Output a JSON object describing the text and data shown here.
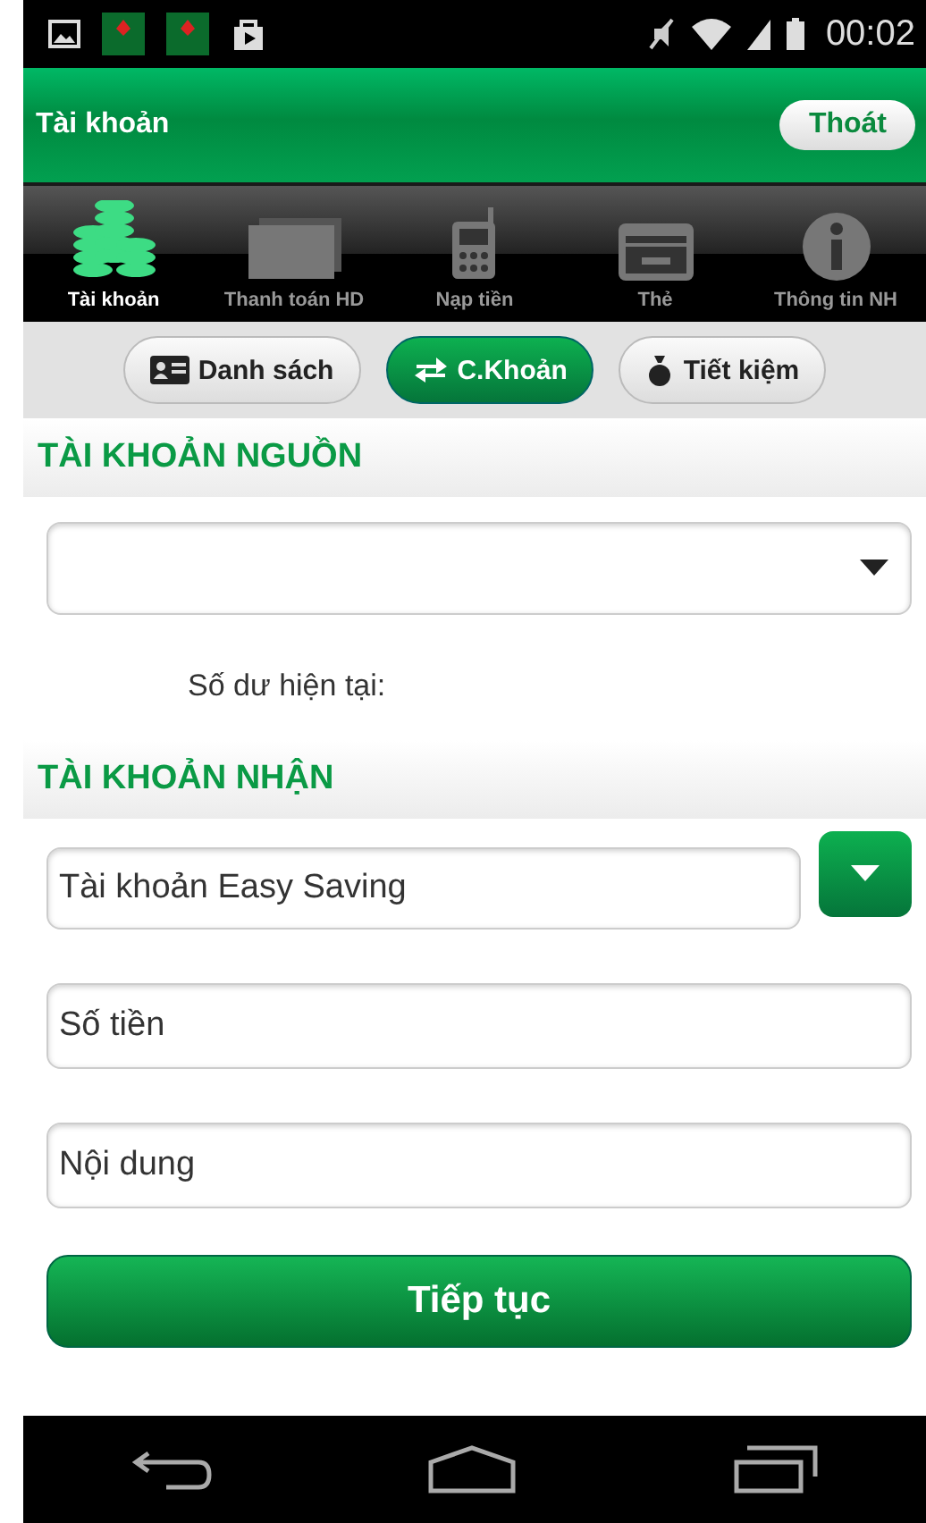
{
  "status_bar": {
    "time": "00:02"
  },
  "header": {
    "title": "Tài khoản",
    "logout_button": "Thoát"
  },
  "tabs": [
    {
      "label": "Tài khoản",
      "selected": true
    },
    {
      "label": "Thanh toán HD",
      "selected": false
    },
    {
      "label": "Nạp tiền",
      "selected": false
    },
    {
      "label": "Thẻ",
      "selected": false
    },
    {
      "label": "Thông tin NH",
      "selected": false
    }
  ],
  "segments": [
    {
      "label": "Danh sách",
      "selected": false
    },
    {
      "label": "C.Khoản",
      "selected": true
    },
    {
      "label": "Tiết kiệm",
      "selected": false
    }
  ],
  "source_section": {
    "title": "TÀI KHOẢN NGUỒN",
    "balance_label": "Số dư hiện tại:"
  },
  "target_section": {
    "title": "TÀI KHOẢN NHẬN",
    "account_value": "Tài khoản Easy Saving"
  },
  "amount_field": {
    "placeholder": "Số tiền"
  },
  "content_field": {
    "placeholder": "Nội dung"
  },
  "continue_button": "Tiếp tục"
}
